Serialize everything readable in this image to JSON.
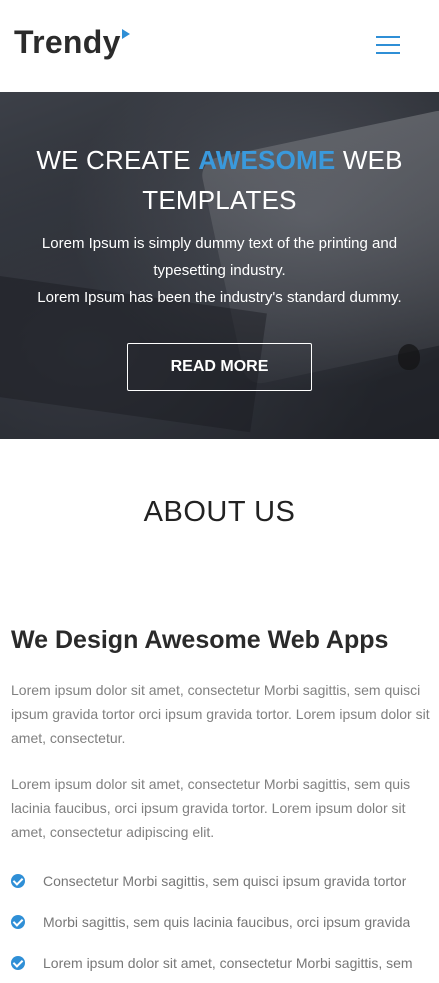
{
  "header": {
    "logo_text": "Trendy",
    "menu_icon": "hamburger-menu-icon",
    "accent_color": "#2f8fd6"
  },
  "hero": {
    "title_part1": "WE CREATE ",
    "title_accent": "AWESOME",
    "title_part2": " WEB TEMPLATES",
    "subtitle_line1": "Lorem Ipsum is simply dummy text of the printing and typesetting industry.",
    "subtitle_line2": "Lorem Ipsum has been the industry's standard dummy.",
    "button_label": "READ MORE"
  },
  "about": {
    "section_title": "ABOUT US",
    "heading": "We Design Awesome Web Apps",
    "paragraph_1": "Lorem ipsum dolor sit amet, consectetur Morbi sagittis, sem quisci ipsum gravida tortor orci ipsum gravida tortor. Lorem ipsum dolor sit amet, consectetur.",
    "paragraph_2": "Lorem ipsum dolor sit amet, consectetur Morbi sagittis, sem quis lacinia faucibus, orci ipsum gravida tortor. Lorem ipsum dolor sit amet, consectetur adipiscing elit.",
    "features": [
      "Consectetur Morbi sagittis, sem quisci ipsum gravida tortor",
      "Morbi sagittis, sem quis lacinia faucibus, orci ipsum gravida",
      "Lorem ipsum dolor sit amet, consectetur Morbi sagittis, sem"
    ]
  }
}
